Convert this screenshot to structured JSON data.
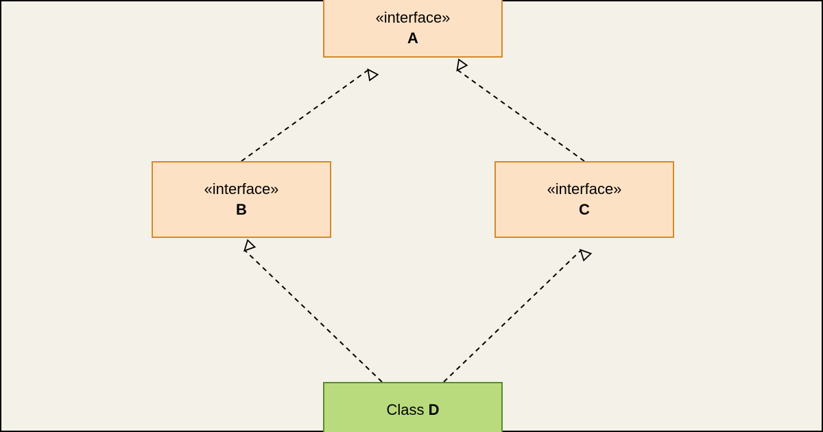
{
  "diagram": {
    "type": "uml-class-diagram",
    "elements": {
      "A": {
        "kind": "interface",
        "stereotype": "«interface»",
        "name": "A"
      },
      "B": {
        "kind": "interface",
        "stereotype": "«interface»",
        "name": "B"
      },
      "C": {
        "kind": "interface",
        "stereotype": "«interface»",
        "name": "C"
      },
      "D": {
        "kind": "class",
        "label_prefix": "Class ",
        "name": "D"
      }
    },
    "relationships": [
      {
        "from": "B",
        "to": "A",
        "type": "realization"
      },
      {
        "from": "C",
        "to": "A",
        "type": "realization"
      },
      {
        "from": "D",
        "to": "B",
        "type": "realization"
      },
      {
        "from": "D",
        "to": "C",
        "type": "realization"
      }
    ],
    "colors": {
      "canvas_bg": "#f4f1e8",
      "interface_fill": "#fce1c5",
      "interface_border": "#d28a2c",
      "class_fill": "#b9db7e",
      "class_border": "#5b8a2a",
      "frame_border": "#000000"
    }
  }
}
